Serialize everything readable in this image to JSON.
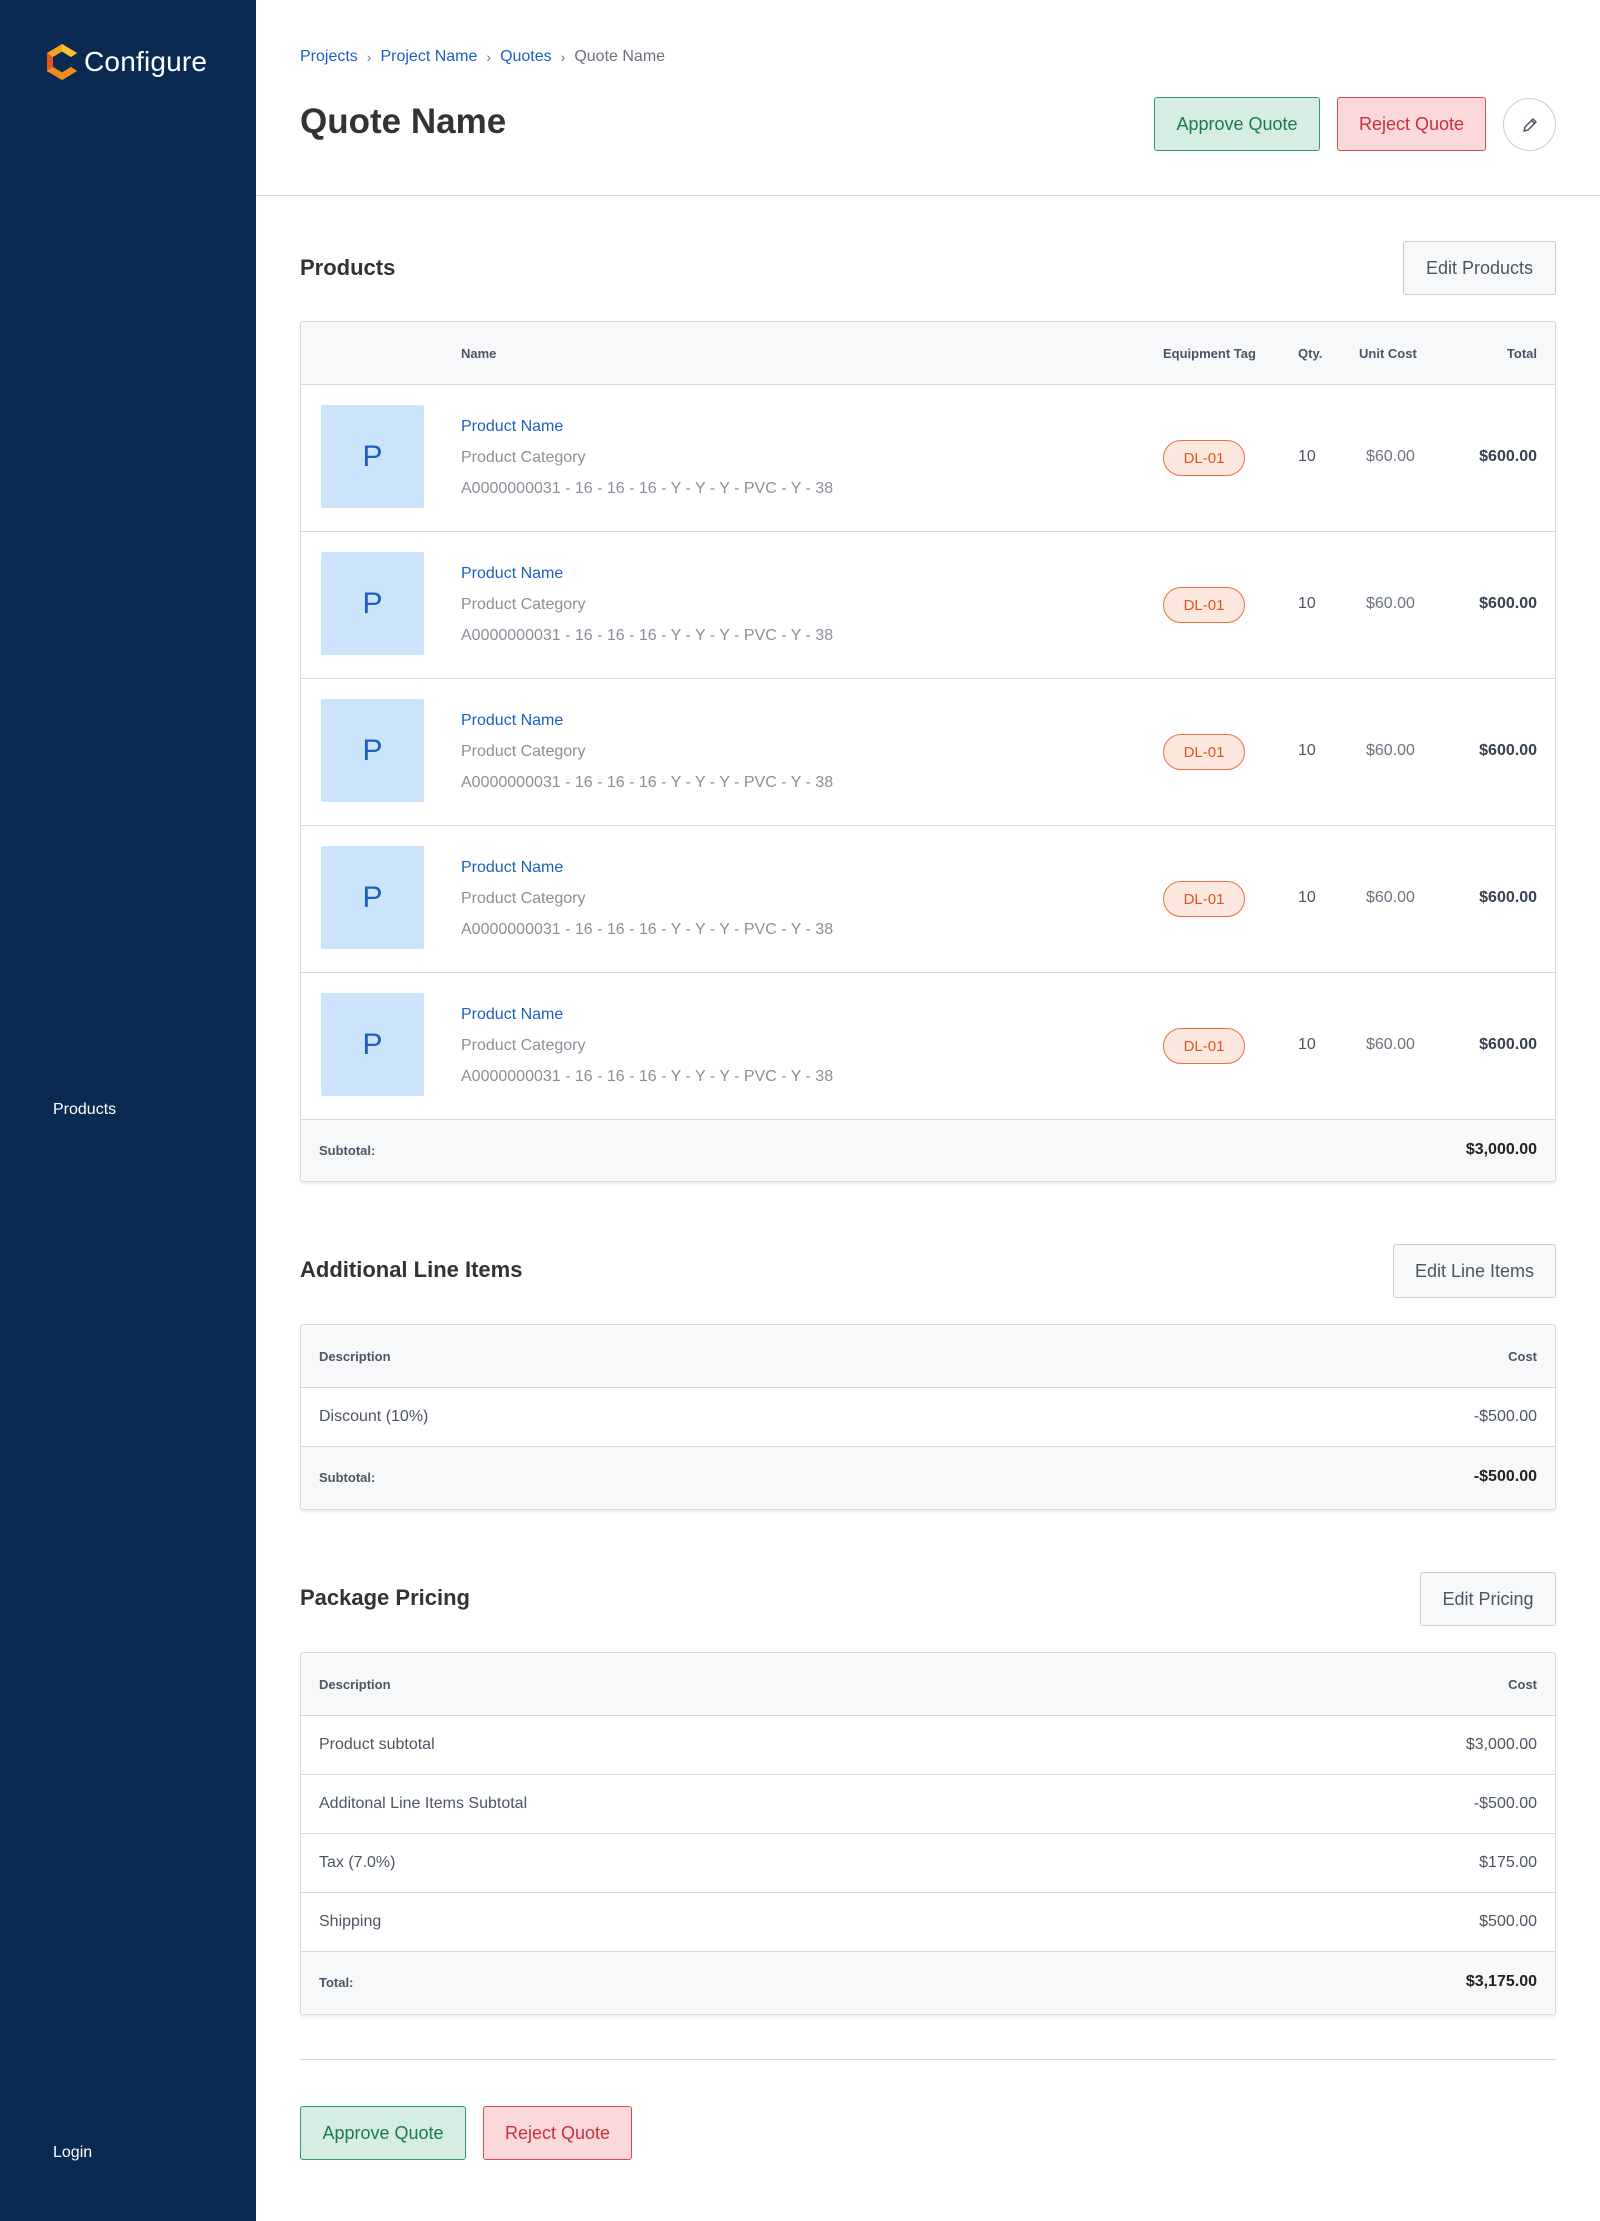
{
  "app": {
    "name": "Configure"
  },
  "sidebar": {
    "items": [
      {
        "label": "Products"
      },
      {
        "label": "Login"
      }
    ]
  },
  "breadcrumb": [
    "Projects",
    "Project Name",
    "Quotes",
    "Quote Name"
  ],
  "page_title": "Quote Name",
  "actions": {
    "approve": "Approve Quote",
    "reject": "Reject Quote",
    "edit_icon": "pencil-icon"
  },
  "products": {
    "title": "Products",
    "edit_label": "Edit Products",
    "columns": {
      "name": "Name",
      "tag": "Equipment Tag",
      "qty": "Qty.",
      "unit": "Unit Cost",
      "total": "Total"
    },
    "rows": [
      {
        "thumb": "P",
        "name": "Product Name",
        "category": "Product Category",
        "sku": "A0000000031 - 16 - 16 - 16 - Y - Y - Y - PVC - Y - 38",
        "tag": "DL-01",
        "qty": "10",
        "unit_cost": "$60.00",
        "total": "$600.00"
      },
      {
        "thumb": "P",
        "name": "Product Name",
        "category": "Product Category",
        "sku": "A0000000031 - 16 - 16 - 16 - Y - Y - Y - PVC - Y - 38",
        "tag": "DL-01",
        "qty": "10",
        "unit_cost": "$60.00",
        "total": "$600.00"
      },
      {
        "thumb": "P",
        "name": "Product Name",
        "category": "Product Category",
        "sku": "A0000000031 - 16 - 16 - 16 - Y - Y - Y - PVC - Y - 38",
        "tag": "DL-01",
        "qty": "10",
        "unit_cost": "$60.00",
        "total": "$600.00"
      },
      {
        "thumb": "P",
        "name": "Product Name",
        "category": "Product Category",
        "sku": "A0000000031 - 16 - 16 - 16 - Y - Y - Y - PVC - Y - 38",
        "tag": "DL-01",
        "qty": "10",
        "unit_cost": "$60.00",
        "total": "$600.00"
      },
      {
        "thumb": "P",
        "name": "Product Name",
        "category": "Product Category",
        "sku": "A0000000031 - 16 - 16 - 16 - Y - Y - Y - PVC - Y - 38",
        "tag": "DL-01",
        "qty": "10",
        "unit_cost": "$60.00",
        "total": "$600.00"
      }
    ],
    "subtotal_label": "Subtotal:",
    "subtotal_value": "$3,000.00"
  },
  "line_items": {
    "title": "Additional Line Items",
    "edit_label": "Edit Line Items",
    "columns": {
      "description": "Description",
      "cost": "Cost"
    },
    "rows": [
      {
        "description": "Discount (10%)",
        "cost": "-$500.00"
      }
    ],
    "subtotal_label": "Subtotal:",
    "subtotal_value": "-$500.00"
  },
  "pricing": {
    "title": "Package Pricing",
    "edit_label": "Edit Pricing",
    "columns": {
      "description": "Description",
      "cost": "Cost"
    },
    "rows": [
      {
        "description": "Product subtotal",
        "cost": "$3,000.00"
      },
      {
        "description": "Additonal Line Items Subtotal",
        "cost": "-$500.00"
      },
      {
        "description": "Tax (7.0%)",
        "cost": "$175.00"
      },
      {
        "description": "Shipping",
        "cost": "$500.00"
      }
    ],
    "total_label": "Total:",
    "total_value": "$3,175.00"
  },
  "colors": {
    "sidebar": "#0b2a52",
    "link": "#1d5fbf",
    "approve": "#2f9b6c",
    "reject": "#d64a55",
    "tag": "#ef6c3c"
  }
}
